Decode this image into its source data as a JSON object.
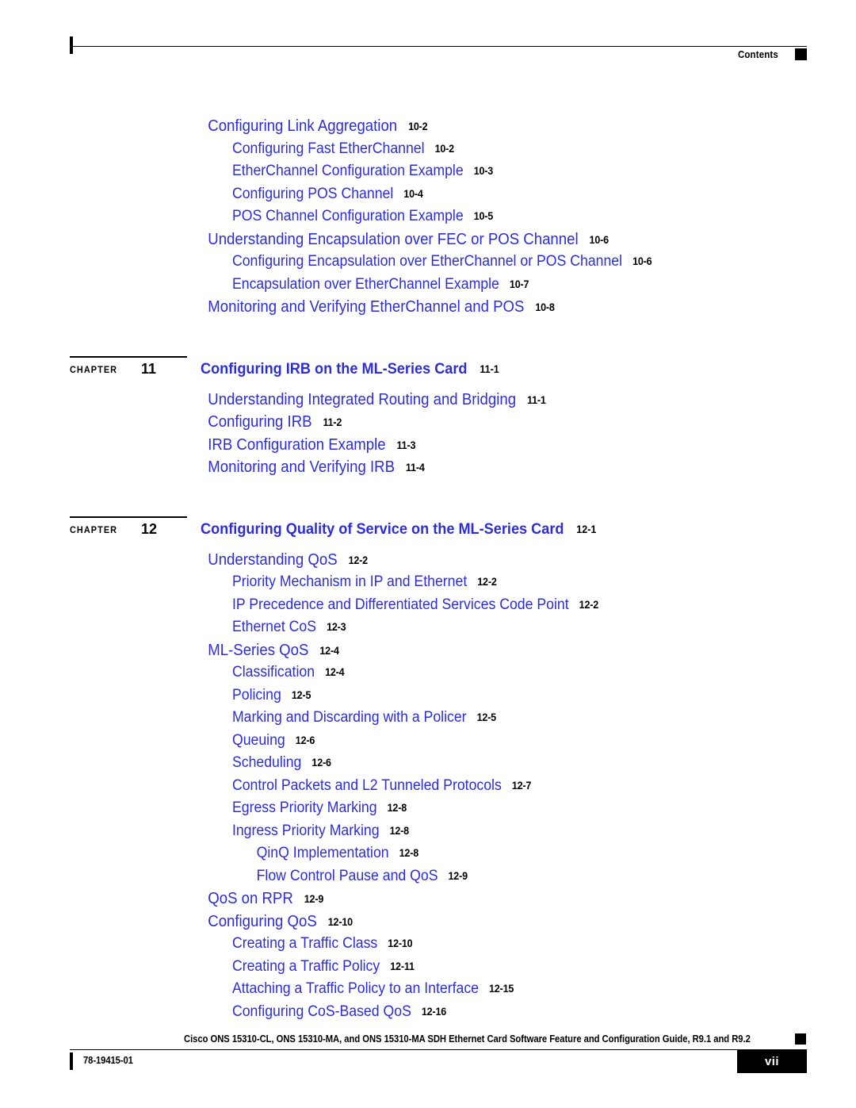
{
  "header": {
    "label": "Contents",
    "square_icon": "black-square-marker"
  },
  "document": {
    "accent_color": "#2d2dd6",
    "text_color": "#000000"
  },
  "toc": {
    "blocks": [
      {
        "type": "entries",
        "entries": [
          {
            "level": 1,
            "title": "Configuring Link Aggregation",
            "page": "10-2"
          },
          {
            "level": 2,
            "title": "Configuring Fast EtherChannel",
            "page": "10-2"
          },
          {
            "level": 2,
            "title": "EtherChannel Configuration Example",
            "page": "10-3"
          },
          {
            "level": 2,
            "title": "Configuring POS Channel",
            "page": "10-4"
          },
          {
            "level": 2,
            "title": "POS Channel Configuration Example",
            "page": "10-5"
          },
          {
            "level": 1,
            "title": "Understanding Encapsulation over FEC or POS Channel",
            "page": "10-6"
          },
          {
            "level": 2,
            "title": "Configuring Encapsulation over EtherChannel or POS Channel",
            "page": "10-6"
          },
          {
            "level": 2,
            "title": "Encapsulation over EtherChannel Example",
            "page": "10-7"
          },
          {
            "level": 1,
            "title": "Monitoring and Verifying EtherChannel and POS",
            "page": "10-8"
          }
        ]
      },
      {
        "type": "chapter",
        "chapter_word": "CHAPTER",
        "chapter_number": "11",
        "title": "Configuring IRB on the ML-Series Card",
        "page": "11-1",
        "entries": [
          {
            "level": 1,
            "title": "Understanding Integrated Routing and Bridging",
            "page": "11-1"
          },
          {
            "level": 1,
            "title": "Configuring IRB",
            "page": "11-2"
          },
          {
            "level": 1,
            "title": "IRB Configuration Example",
            "page": "11-3"
          },
          {
            "level": 1,
            "title": "Monitoring and Verifying IRB",
            "page": "11-4"
          }
        ]
      },
      {
        "type": "chapter",
        "chapter_word": "CHAPTER",
        "chapter_number": "12",
        "title": "Configuring Quality of Service on the ML-Series Card",
        "page": "12-1",
        "entries": [
          {
            "level": 1,
            "title": "Understanding QoS",
            "page": "12-2"
          },
          {
            "level": 2,
            "title": "Priority Mechanism in IP and Ethernet",
            "page": "12-2"
          },
          {
            "level": 2,
            "title": "IP Precedence and Differentiated Services Code Point",
            "page": "12-2"
          },
          {
            "level": 2,
            "title": "Ethernet CoS",
            "page": "12-3"
          },
          {
            "level": 1,
            "title": "ML-Series QoS",
            "page": "12-4"
          },
          {
            "level": 2,
            "title": "Classification",
            "page": "12-4"
          },
          {
            "level": 2,
            "title": "Policing",
            "page": "12-5"
          },
          {
            "level": 2,
            "title": "Marking and Discarding with a Policer",
            "page": "12-5"
          },
          {
            "level": 2,
            "title": "Queuing",
            "page": "12-6"
          },
          {
            "level": 2,
            "title": "Scheduling",
            "page": "12-6"
          },
          {
            "level": 2,
            "title": "Control Packets and L2 Tunneled Protocols",
            "page": "12-7"
          },
          {
            "level": 2,
            "title": "Egress Priority Marking",
            "page": "12-8"
          },
          {
            "level": 2,
            "title": "Ingress Priority Marking",
            "page": "12-8"
          },
          {
            "level": 3,
            "title": "QinQ Implementation",
            "page": "12-8"
          },
          {
            "level": 3,
            "title": "Flow Control Pause and QoS",
            "page": "12-9"
          },
          {
            "level": 1,
            "title": "QoS on RPR",
            "page": "12-9"
          },
          {
            "level": 1,
            "title": "Configuring QoS",
            "page": "12-10"
          },
          {
            "level": 2,
            "title": "Creating a Traffic Class",
            "page": "12-10"
          },
          {
            "level": 2,
            "title": "Creating a Traffic Policy",
            "page": "12-11"
          },
          {
            "level": 2,
            "title": "Attaching a Traffic Policy to an Interface",
            "page": "12-15"
          },
          {
            "level": 2,
            "title": "Configuring CoS-Based QoS",
            "page": "12-16"
          }
        ]
      }
    ]
  },
  "footer": {
    "guide_title": "Cisco ONS 15310-CL, ONS 15310-MA, and ONS 15310-MA SDH Ethernet Card Software Feature and Configuration Guide, R9.1 and R9.2",
    "doc_number": "78-19415-01",
    "page_number": "vii",
    "square_icon": "black-square-marker"
  }
}
